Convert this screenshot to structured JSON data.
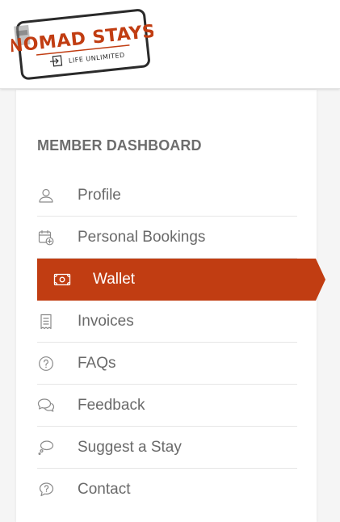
{
  "brand": {
    "name": "NOMAD STAYS",
    "tagline": "LIFE UNLIMITED",
    "color": "#c13d12"
  },
  "dashboard": {
    "title": "MEMBER DASHBOARD",
    "active_color": "#c13d12",
    "items": [
      {
        "label": "Profile",
        "icon": "user-icon"
      },
      {
        "label": "Personal Bookings",
        "icon": "calendar-add-icon"
      },
      {
        "label": "Wallet",
        "icon": "wallet-icon",
        "active": true
      },
      {
        "label": "Invoices",
        "icon": "receipt-icon"
      },
      {
        "label": "FAQs",
        "icon": "question-icon"
      },
      {
        "label": "Feedback",
        "icon": "chat-bubbles-icon"
      },
      {
        "label": "Suggest a Stay",
        "icon": "thought-bubble-icon"
      },
      {
        "label": "Contact",
        "icon": "question-chat-icon"
      }
    ]
  }
}
